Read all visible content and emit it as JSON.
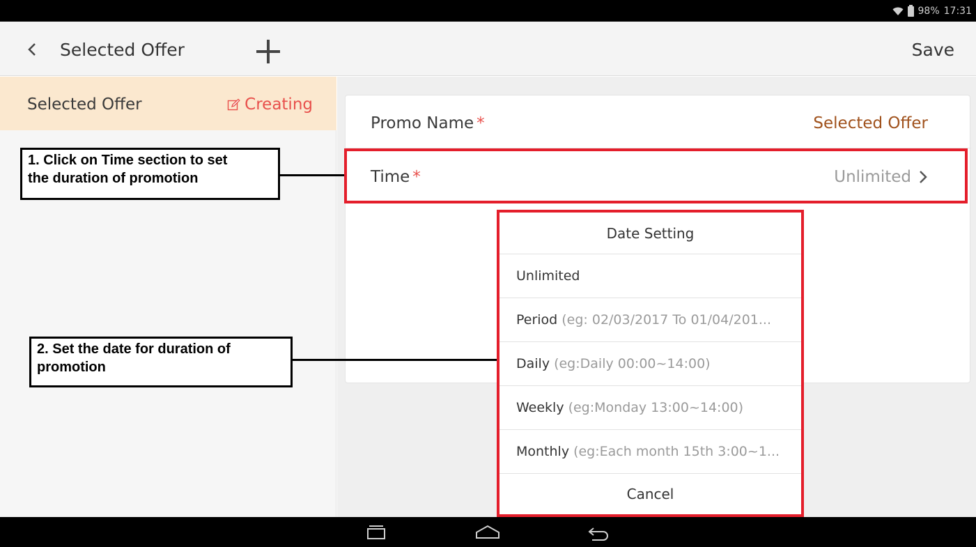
{
  "status_bar": {
    "battery": "98%",
    "time": "17:31"
  },
  "app_bar": {
    "title": "Selected Offer",
    "save_label": "Save"
  },
  "left_panel": {
    "item_name": "Selected Offer",
    "item_status": "Creating"
  },
  "form": {
    "promo_name_label": "Promo Name",
    "required_mark": "*",
    "promo_name_value": "Selected Offer",
    "time_label": "Time",
    "time_value": "Unlimited"
  },
  "dialog": {
    "title": "Date Setting",
    "options": [
      {
        "label": "Unlimited",
        "hint": ""
      },
      {
        "label": "Period",
        "hint": "(eg: 02/03/2017 To 01/04/201..."
      },
      {
        "label": "Daily",
        "hint": "(eg:Daily 00:00~14:00)"
      },
      {
        "label": "Weekly",
        "hint": "(eg:Monday 13:00~14:00)"
      },
      {
        "label": "Monthly",
        "hint": "(eg:Each month 15th 3:00~1..."
      }
    ],
    "cancel_label": "Cancel"
  },
  "callouts": {
    "step1_line1": "1. Click on Time section to set",
    "step1_line2": "the duration of promotion",
    "step2_line1": "2. Set the date for duration of",
    "step2_line2": "promotion"
  },
  "colors": {
    "accent_red": "#e41e2b",
    "status_red": "#e8504c",
    "value_brown": "#a0521d",
    "selected_item_bg": "#fbe8cf"
  }
}
